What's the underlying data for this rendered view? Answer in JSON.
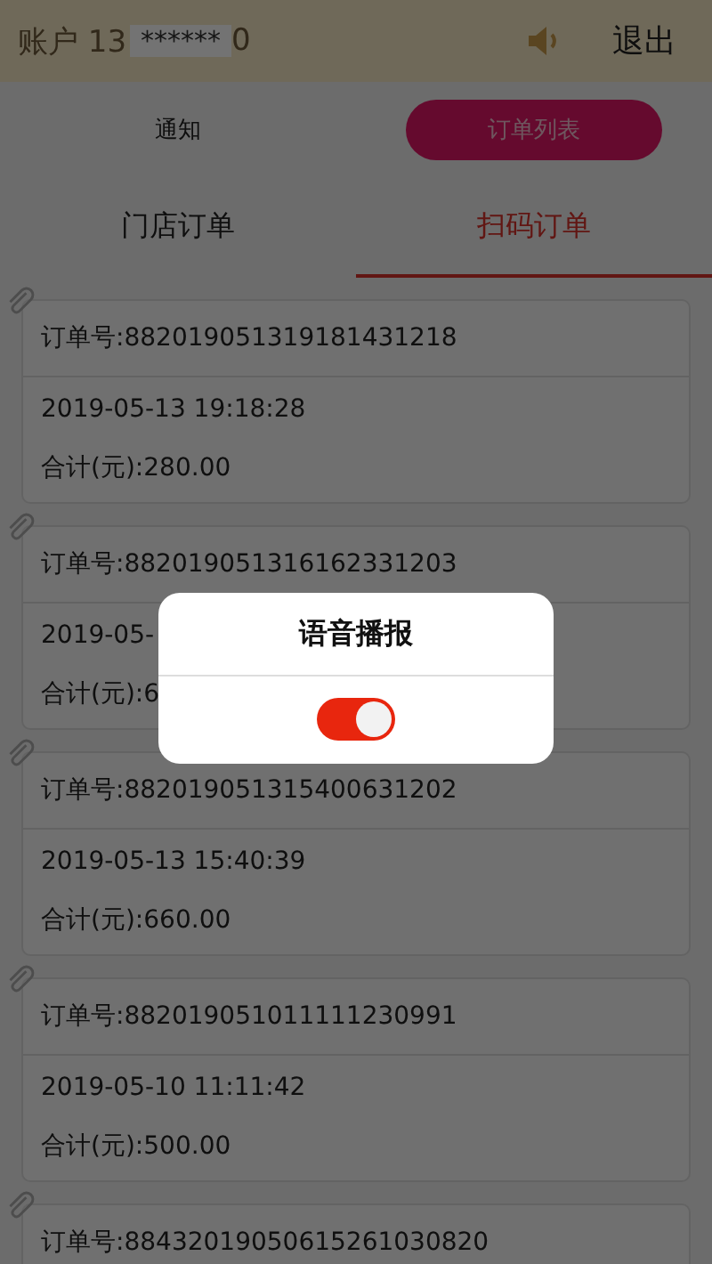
{
  "header": {
    "account_prefix": "账户 13",
    "account_masked": "******",
    "account_suffix": "0",
    "logout": "退出"
  },
  "segments": [
    {
      "label": "通知",
      "selected": false
    },
    {
      "label": "订单列表",
      "selected": true
    }
  ],
  "tabs": [
    {
      "label": "门店订单",
      "selected": false
    },
    {
      "label": "扫码订单",
      "selected": true
    }
  ],
  "orders": [
    {
      "number": "订单号:882019051319181431218",
      "time": "2019-05-13 19:18:28",
      "total": "合计(元):280.00"
    },
    {
      "number": "订单号:882019051316162331203",
      "time": "2019-05-",
      "total": "合计(元):6"
    },
    {
      "number": "订单号:882019051315400631202",
      "time": "2019-05-13 15:40:39",
      "total": "合计(元):660.00"
    },
    {
      "number": "订单号:882019051011111230991",
      "time": "2019-05-10 11:11:42",
      "total": "合计(元):500.00"
    },
    {
      "number": "订单号:88432019050615261030820"
    }
  ],
  "dialog": {
    "title": "语音播报",
    "on": true
  }
}
